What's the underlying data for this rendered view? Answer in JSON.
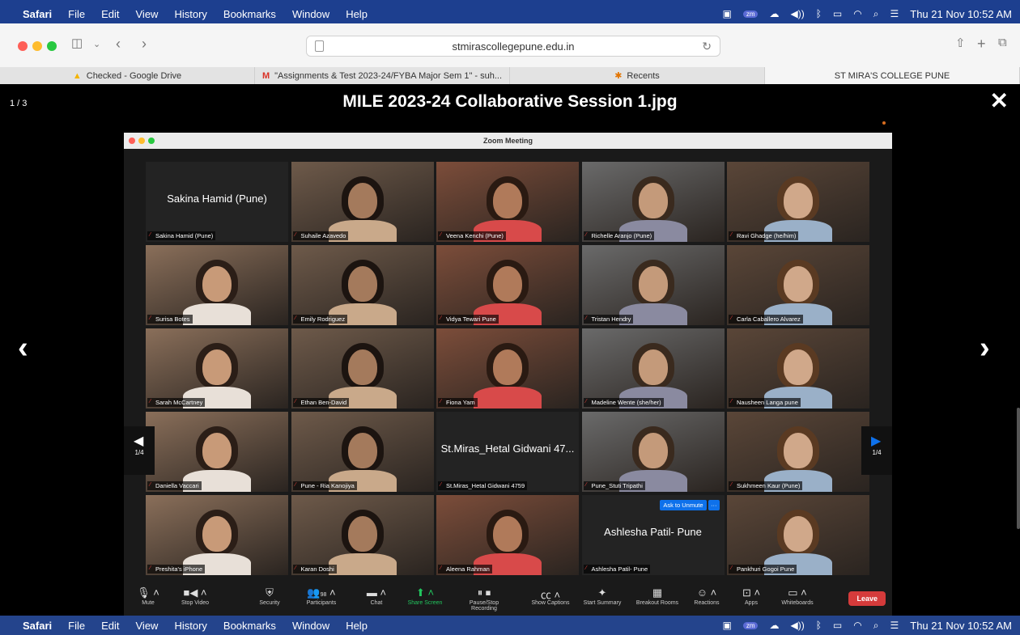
{
  "menubar": {
    "app": "Safari",
    "items": [
      "File",
      "Edit",
      "View",
      "History",
      "Bookmarks",
      "Window",
      "Help"
    ],
    "clock": "Thu 21 Nov  10:52 AM"
  },
  "browser": {
    "url": "stmirascollegepune.edu.in",
    "tabs": [
      {
        "label": "Checked - Google Drive",
        "icon": "google-drive-icon"
      },
      {
        "label": "\"Assignments & Test 2023-24/FYBA Major Sem 1\" - suh...",
        "icon": "gmail-icon"
      },
      {
        "label": "Recents",
        "icon": "recents-icon"
      },
      {
        "label": "ST MIRA'S COLLEGE PUNE",
        "icon": ""
      }
    ]
  },
  "viewer": {
    "counter": "1 / 3",
    "title": "MILE 2023-24 Collaborative Session 1.jpg"
  },
  "zoom": {
    "window_title": "Zoom Meeting",
    "page_left": "1/4",
    "page_right": "1/4",
    "ask_unmute": "Ask to Unmute",
    "more": "···",
    "participants": [
      {
        "name": "Sakina Hamid (Pune)",
        "big": "Sakina Hamid (Pune)"
      },
      {
        "name": "Suhaile Azavedo"
      },
      {
        "name": "Veena Kenchi (Pune)"
      },
      {
        "name": "Richelle Aranjo (Pune)"
      },
      {
        "name": "Ravi Ghadge (he/him)"
      },
      {
        "name": "Surisa Botes"
      },
      {
        "name": "Emily Rodriguez"
      },
      {
        "name": "Vidya Tewari Pune"
      },
      {
        "name": "Tristan Hendry"
      },
      {
        "name": "Carla Caballero Alvarez"
      },
      {
        "name": "Sarah McCartney"
      },
      {
        "name": "Ethan Ben-David"
      },
      {
        "name": "Fiona Yam"
      },
      {
        "name": "Madeline Wente (she/her)"
      },
      {
        "name": "Nausheen Langa pune"
      },
      {
        "name": "Daniella Vaccari"
      },
      {
        "name": "Pune - Ria Kanojiya"
      },
      {
        "name": "St.Miras_Hetal Gidwani 4759",
        "big": "St.Miras_Hetal Gidwani 47..."
      },
      {
        "name": "Pune_Stuti Tripathi"
      },
      {
        "name": "Sukhmeen Kaur (Pune)"
      },
      {
        "name": "Preshita's iPhone"
      },
      {
        "name": "Karan Doshi"
      },
      {
        "name": "Aleena Rahman"
      },
      {
        "name": "Ashlesha Patil- Pune",
        "big": "Ashlesha Patil- Pune"
      },
      {
        "name": "Pankhuri Gogoi Pune"
      }
    ],
    "toolbar": {
      "mute": "Mute",
      "stop_video": "Stop Video",
      "security": "Security",
      "participants": "Participants",
      "participants_count": "98",
      "chat": "Chat",
      "share": "Share Screen",
      "record": "Pause/Stop Recording",
      "captions": "Show Captions",
      "summary": "Start Summary",
      "breakout": "Breakout Rooms",
      "reactions": "Reactions",
      "apps": "Apps",
      "whiteboards": "Whiteboards",
      "leave": "Leave"
    }
  }
}
